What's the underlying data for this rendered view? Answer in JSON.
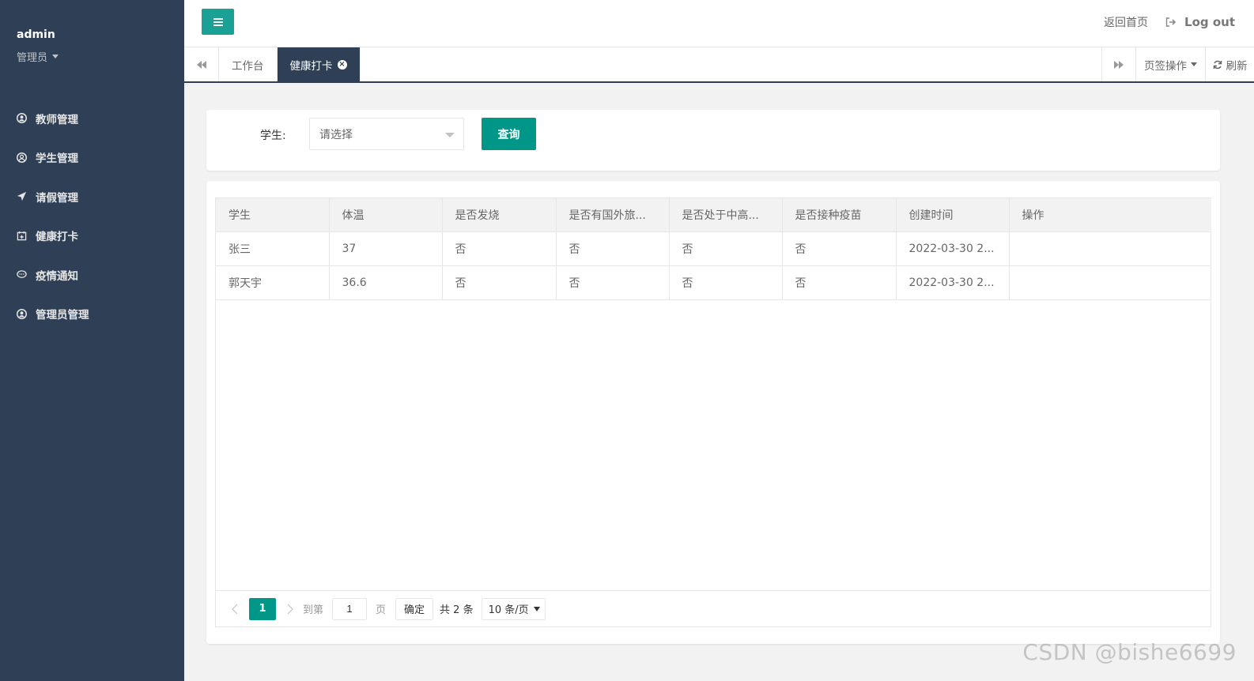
{
  "sidebar": {
    "user_name": "admin",
    "user_role": "管理员",
    "items": [
      {
        "label": "教师管理",
        "icon": "user-circle-icon"
      },
      {
        "label": "学生管理",
        "icon": "user-circle-icon"
      },
      {
        "label": "请假管理",
        "icon": "paper-plane-icon"
      },
      {
        "label": "健康打卡",
        "icon": "calendar-plus-icon"
      },
      {
        "label": "疫情通知",
        "icon": "comment-icon"
      },
      {
        "label": "管理员管理",
        "icon": "user-circle-icon"
      }
    ]
  },
  "header": {
    "home_link": "返回首页",
    "logout": "Log out"
  },
  "tabs": {
    "items": [
      "工作台",
      "健康打卡"
    ],
    "active": "健康打卡",
    "ops_label": "页签操作",
    "refresh_label": "刷新"
  },
  "search": {
    "label": "学生:",
    "placeholder": "请选择",
    "button": "查询"
  },
  "table": {
    "columns": [
      "学生",
      "体温",
      "是否发烧",
      "是否有国外旅...",
      "是否处于中高...",
      "是否接种疫苗",
      "创建时间",
      "操作"
    ],
    "rows": [
      [
        "张三",
        "37",
        "否",
        "否",
        "否",
        "否",
        "2022-03-30 2...",
        ""
      ],
      [
        "郭天宇",
        "36.6",
        "否",
        "否",
        "否",
        "否",
        "2022-03-30 2...",
        ""
      ]
    ]
  },
  "pagination": {
    "current": "1",
    "goto_label": "到第",
    "page_value": "1",
    "page_suffix": "页",
    "confirm": "确定",
    "total": "共 2 条",
    "page_size": "10 条/页"
  },
  "watermark": "CSDN @bishe6699",
  "colors": {
    "sidebar_bg": "#2f4056",
    "accent": "#009688",
    "menu_button": "#1aa094"
  }
}
